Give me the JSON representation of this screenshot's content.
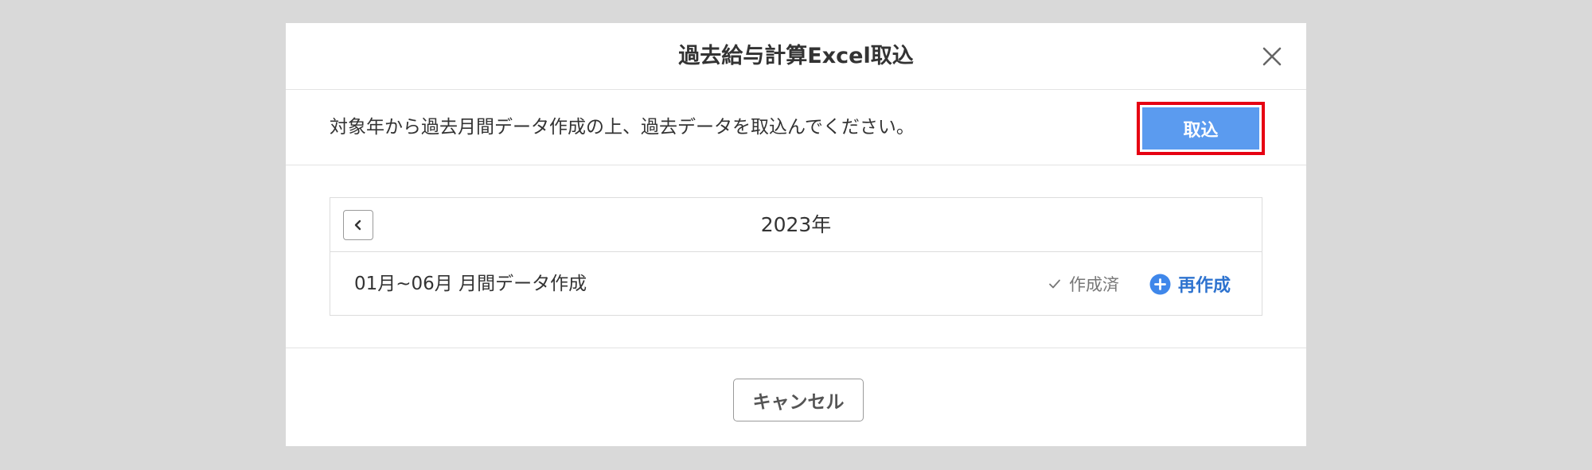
{
  "dialog": {
    "title": "過去給与計算Excel取込",
    "close_icon": "close-icon"
  },
  "info": {
    "message": "対象年から過去月間データ作成の上、過去データを取込んでください。",
    "import_label": "取込",
    "highlight_color": "#e60012",
    "button_color": "#5b9bef"
  },
  "year_panel": {
    "prev_icon": "chevron-left-icon",
    "year": "2023年",
    "rows": [
      {
        "label": "01月~06月 月間データ作成",
        "status": "作成済",
        "status_icon": "check-icon",
        "action_label": "再作成",
        "action_icon": "plus-circle-icon",
        "action_color": "#2e73cf"
      }
    ]
  },
  "footer": {
    "cancel_label": "キャンセル"
  }
}
